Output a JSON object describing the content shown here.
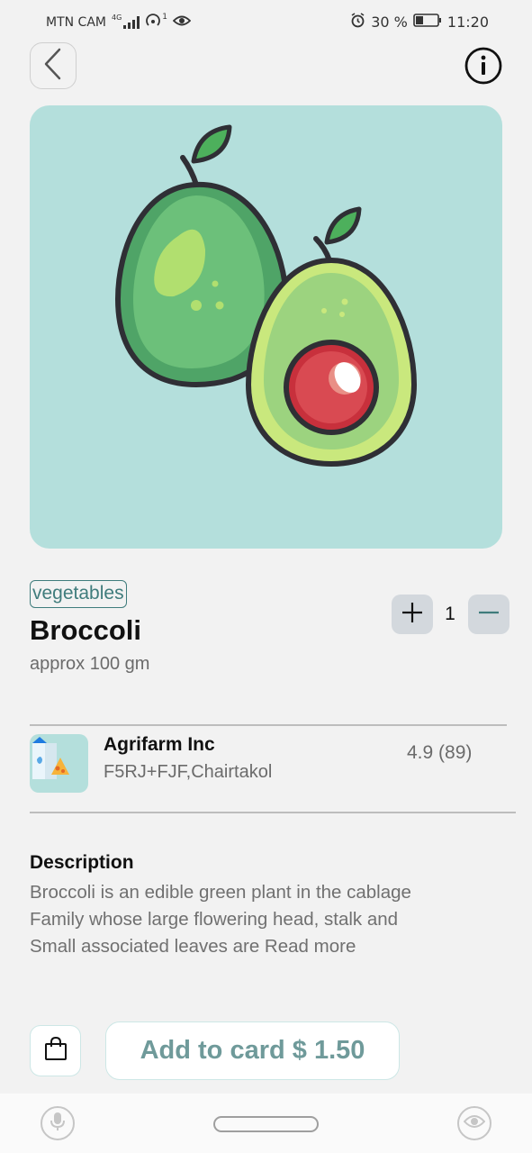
{
  "status_bar": {
    "carrier": "MTN CAM",
    "network_type": "4G",
    "hotspot_count": "1",
    "battery": "30 %",
    "time": "11:20"
  },
  "header": {
    "back_icon": "chevron-left-icon",
    "info_icon": "info-icon"
  },
  "product": {
    "image_icon": "avocado-illustration",
    "category": "vegetables",
    "name": "Broccoli",
    "weight": "approx 100 gm",
    "quantity": "1",
    "plus_icon": "plus-icon",
    "minus_icon": "minus-icon"
  },
  "seller": {
    "logo_icon": "farm-logo-icon",
    "name": "Agrifarm Inc",
    "address": "F5RJ+FJF,Chairtakol",
    "rating": "4.9 (89)"
  },
  "description": {
    "heading": "Description",
    "line1": "Broccoli is an edible green plant in the cablage",
    "line2": "Family whose large flowering head, stalk and",
    "line3": "Small associated leaves are Read more"
  },
  "actions": {
    "bag_icon": "shopping-bag-icon",
    "add_to_cart_label": "Add to card $ 1.50"
  },
  "nav_bar": {
    "mic_icon": "microphone-icon",
    "home_icon": "home-pill-icon",
    "eye_icon": "eye-icon"
  },
  "colors": {
    "accent": "#3f7c7c",
    "hero_background": "#b4dfdc",
    "page_background": "#f2f2f2"
  }
}
